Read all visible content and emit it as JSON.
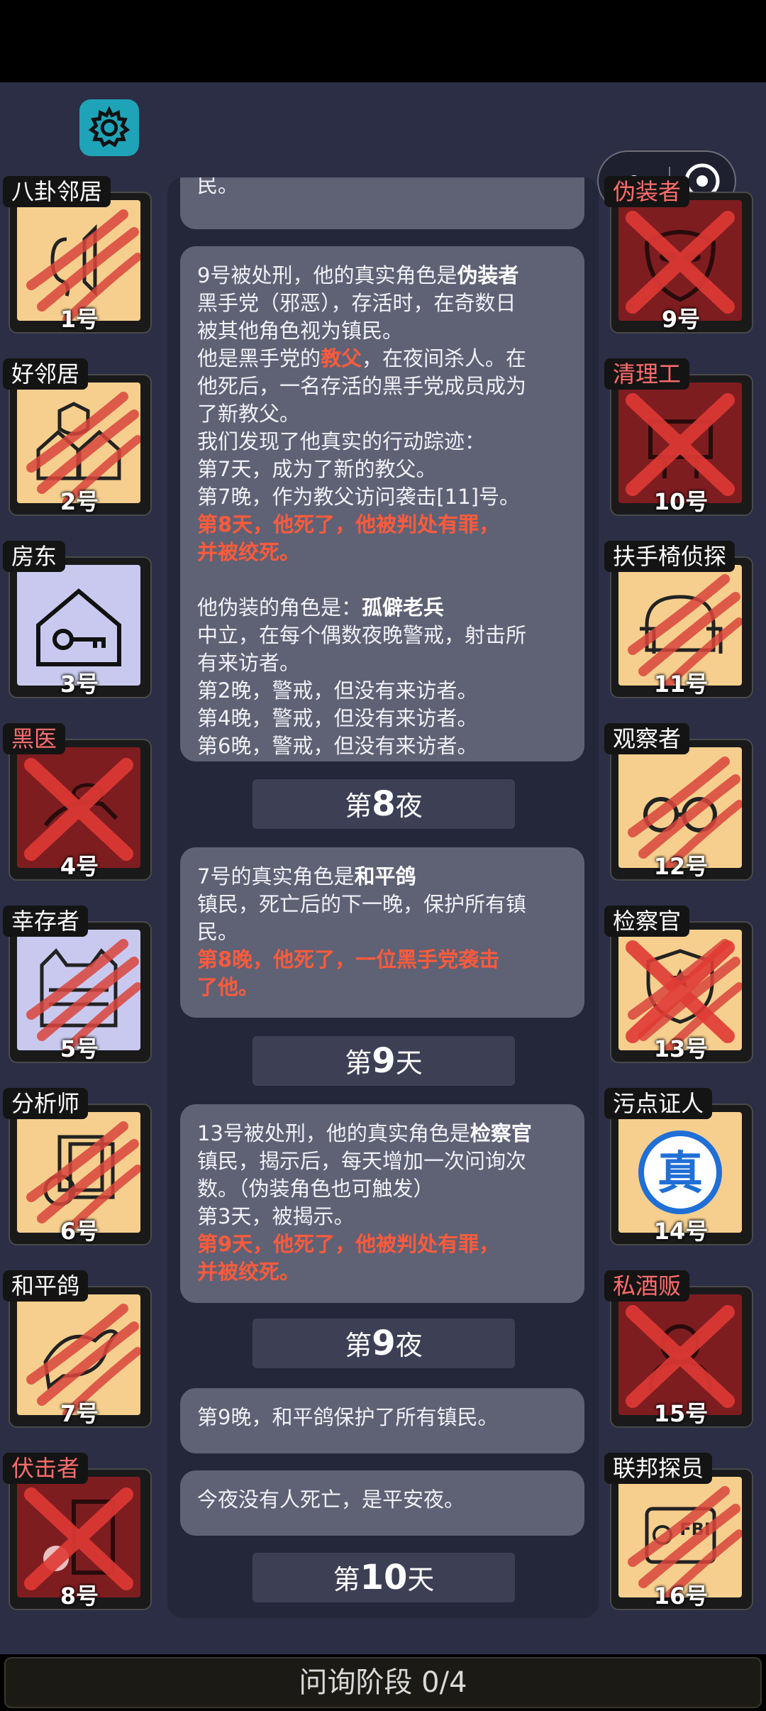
{
  "capsule": {
    "more_icon": "more-dots-icon",
    "close_icon": "circle-target-icon"
  },
  "settings": {
    "icon": "gear-icon"
  },
  "messages": [
    {
      "lines": [
        {
          "t": "民。"
        }
      ]
    },
    {
      "lines": [
        {
          "parts": [
            {
              "t": "9号被处刑，他的真实角色是"
            },
            {
              "t": "伪装者",
              "s": "b"
            }
          ]
        },
        {
          "t": "黑手党（邪恶），存活时，在奇数日"
        },
        {
          "t": "被其他角色视为镇民。"
        },
        {
          "parts": [
            {
              "t": "他是黑手党的"
            },
            {
              "t": "教父",
              "s": "red"
            },
            {
              "t": "，在夜间杀人。在"
            }
          ]
        },
        {
          "t": "他死后，一名存活的黑手党成员成为"
        },
        {
          "t": "了新教父。"
        },
        {
          "t": "我们发现了他真实的行动踪迹："
        },
        {
          "t": "第7天，成为了新的教父。"
        },
        {
          "t": "第7晚，作为教父访问袭击[11]号。"
        },
        {
          "t": "第8天，他死了，他被判处有罪，",
          "s": "red"
        },
        {
          "t": "并被绞死。",
          "s": "red"
        },
        {
          "gap": true
        },
        {
          "parts": [
            {
              "t": "他伪装的角色是："
            },
            {
              "t": "孤僻老兵",
              "s": "b"
            }
          ]
        },
        {
          "t": "中立，在每个偶数夜晚警戒，射击所"
        },
        {
          "t": "有来访者。"
        },
        {
          "t": "第2晚，警戒，但没有来访者。"
        },
        {
          "t": "第4晚，警戒，但没有来访者。"
        },
        {
          "t": "第6晚，警戒，但没有来访者。"
        }
      ]
    },
    {
      "lines": [
        {
          "parts": [
            {
              "t": "7号的真实角色是"
            },
            {
              "t": "和平鸽",
              "s": "b"
            }
          ]
        },
        {
          "t": "镇民，死亡后的下一晚，保护所有镇"
        },
        {
          "t": "民。"
        },
        {
          "t": "第8晚，他死了，一位黑手党袭击",
          "s": "red"
        },
        {
          "t": "了他。",
          "s": "red"
        }
      ]
    },
    {
      "lines": [
        {
          "parts": [
            {
              "t": "13号被处刑，他的真实角色是"
            },
            {
              "t": "检察官",
              "s": "b"
            }
          ]
        },
        {
          "t": "镇民，揭示后，每天增加一次问询次"
        },
        {
          "t": "数。（伪装角色也可触发）"
        },
        {
          "t": "第3天，被揭示。"
        },
        {
          "t": "第9天，他死了，他被判处有罪，",
          "s": "red"
        },
        {
          "t": "并被绞死。",
          "s": "red"
        }
      ]
    },
    {
      "lines": [
        {
          "t": "第9晚，和平鸽保护了所有镇民。"
        }
      ]
    },
    {
      "lines": [
        {
          "t": "今夜没有人死亡，是平安夜。"
        }
      ]
    }
  ],
  "phases": [
    {
      "pre": "第",
      "num": "8",
      "post": "夜"
    },
    {
      "pre": "第",
      "num": "9",
      "post": "天"
    },
    {
      "pre": "第",
      "num": "9",
      "post": "夜"
    },
    {
      "pre": "第",
      "num": "10",
      "post": "天"
    }
  ],
  "left_players": [
    {
      "role": "八卦邻居",
      "num": "1号",
      "status": "clawed",
      "face": "tan",
      "icon": "ear-speaker-icon"
    },
    {
      "role": "好邻居",
      "num": "2号",
      "status": "clawed",
      "face": "tan",
      "icon": "houses-icon"
    },
    {
      "role": "房东",
      "num": "3号",
      "status": "alive",
      "face": "blue",
      "icon": "house-key-icon"
    },
    {
      "role": "黑医",
      "num": "4号",
      "status": "dead",
      "face": "dark",
      "icon": "hand-pill-icon"
    },
    {
      "role": "幸存者",
      "num": "5号",
      "status": "clawed",
      "face": "blue",
      "icon": "vest-icon"
    },
    {
      "role": "分析师",
      "num": "6号",
      "status": "clawed",
      "face": "tan",
      "icon": "documents-magnifier-icon"
    },
    {
      "role": "和平鸽",
      "num": "7号",
      "status": "clawed",
      "face": "tan",
      "icon": "dove-icon"
    },
    {
      "role": "伏击者",
      "num": "8号",
      "status": "dead",
      "face": "dark",
      "icon": "ambusher-door-icon"
    }
  ],
  "right_players": [
    {
      "role": "伪装者",
      "num": "9号",
      "status": "dead",
      "face": "dark",
      "icon": "mask-icon"
    },
    {
      "role": "清理工",
      "num": "10号",
      "status": "dead",
      "face": "dark",
      "icon": "cleaner-icon"
    },
    {
      "role": "扶手椅侦探",
      "num": "11号",
      "status": "clawed",
      "face": "tan",
      "icon": "armchair-icon"
    },
    {
      "role": "观察者",
      "num": "12号",
      "status": "clawed",
      "face": "tan",
      "icon": "binoculars-icon"
    },
    {
      "role": "检察官",
      "num": "13号",
      "status": "dead-x",
      "face": "tan",
      "icon": "badge-emblem-icon"
    },
    {
      "role": "污点证人",
      "num": "14号",
      "status": "alive",
      "face": "tan",
      "icon": "truth-seal-icon",
      "seal_text": "真"
    },
    {
      "role": "私酒贩",
      "num": "15号",
      "status": "dead",
      "face": "dark",
      "icon": "bootlegger-icon"
    },
    {
      "role": "联邦探员",
      "num": "16号",
      "status": "clawed",
      "face": "tan",
      "icon": "fbi-card-icon",
      "badge_text": "FBI"
    }
  ],
  "footer": {
    "label": "问询阶段 0/4"
  }
}
